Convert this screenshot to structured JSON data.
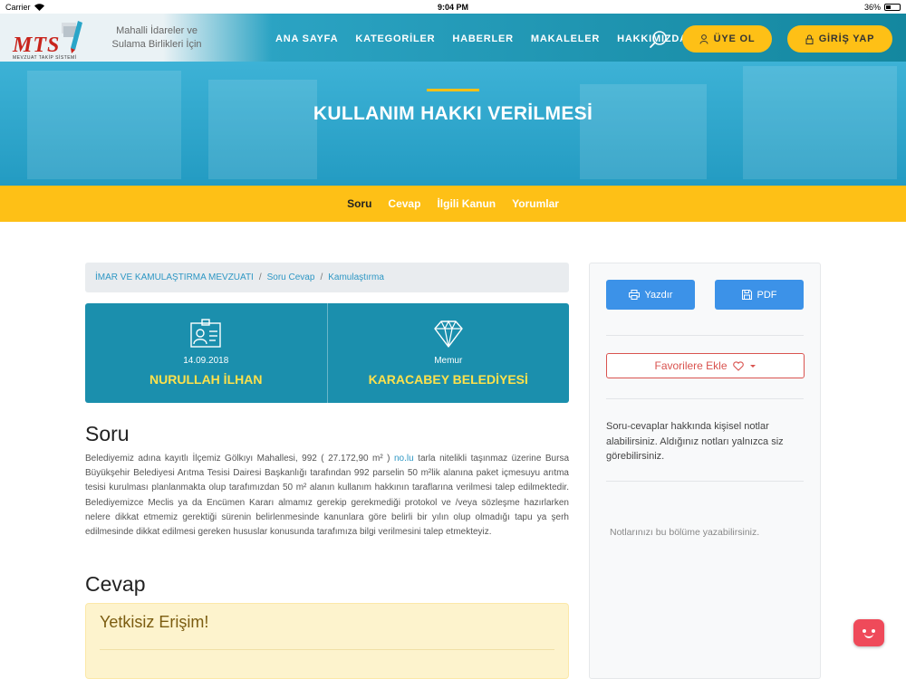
{
  "status_bar": {
    "carrier": "Carrier",
    "time": "9:04 PM",
    "battery": "36%"
  },
  "header": {
    "logo_text": "MTS",
    "logo_subtext": "MEVZUAT TAKİP SİSTEMİ",
    "tagline": "Mahalli İdareler ve Sulama Birlikleri İçin",
    "nav": [
      "ANA SAYFA",
      "KATEGORİLER",
      "HABERLER",
      "MAKALELER",
      "HAKKIMIZDA"
    ],
    "register_label": "ÜYE OL",
    "login_label": "GİRİŞ YAP"
  },
  "hero": {
    "title": "KULLANIM HAKKI VERİLMESİ"
  },
  "subnav": [
    "Soru",
    "Cevap",
    "İlgili Kanun",
    "Yorumlar"
  ],
  "breadcrumb": [
    "İMAR VE KAMULAŞTIRMA MEVZUATI",
    "Soru Cevap",
    "Kamulaştırma"
  ],
  "info": {
    "date": "14.09.2018",
    "author": "NURULLAH İLHAN",
    "role": "Memur",
    "institution": "KARACABEY BELEDİYESİ"
  },
  "question": {
    "heading": "Soru",
    "text_before": "Belediyemiz adına kayıtlı İlçemiz Gölkıyı Mahallesi, 992 ( 27.172,90 m² ) ",
    "link": "no.lu",
    "text_after": " tarla nitelikli taşınmaz üzerine Bursa Büyükşehir Belediyesi Arıtma Tesisi Dairesi Başkanlığı tarafından 992 parselin 50 m²lik alanına paket içmesuyu arıtma tesisi kurulması planlanmakta olup tarafımızdan 50 m² alanın kullanım hakkının taraflarına verilmesi talep edilmektedir. Belediyemizce Meclis ya da Encümen Kararı almamız gerekip gerekmediği protokol ve /veya sözleşme hazırlarken nelere dikkat etmemiz gerektiği sürenin belirlenmesinde kanunlara göre belirli bir yılın olup olmadığı tapu ya şerh edilmesinde dikkat edilmesi gereken hususlar konusunda tarafımıza bilgi verilmesini talep etmekteyiz."
  },
  "answer": {
    "heading": "Cevap",
    "alert": "Yetkisiz Erişim!"
  },
  "sidebar": {
    "print_label": "Yazdır",
    "pdf_label": "PDF",
    "favorite_label": "Favorilere Ekle",
    "notes_info": "Soru-cevaplar hakkında kişisel notlar alabilirsiniz. Aldığınız notları yalnızca siz görebilirsiniz.",
    "notes_placeholder": "Notlarınızı bu bölüme yazabilirsiniz."
  },
  "colors": {
    "accent": "#fec016",
    "primary": "#1b8fad",
    "link": "#2e97c4",
    "danger": "#d9534f"
  }
}
